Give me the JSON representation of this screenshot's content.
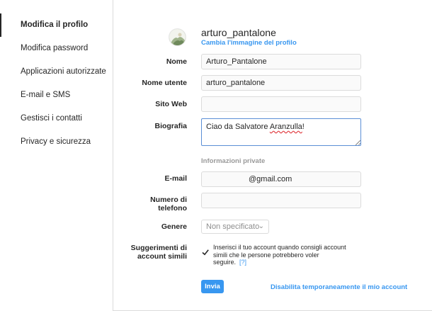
{
  "sidebar": {
    "items": [
      {
        "label": "Modifica il profilo",
        "active": true
      },
      {
        "label": "Modifica password"
      },
      {
        "label": "Applicazioni autorizzate"
      },
      {
        "label": "E-mail e SMS"
      },
      {
        "label": "Gestisci i contatti"
      },
      {
        "label": "Privacy e sicurezza"
      }
    ]
  },
  "profile": {
    "username": "arturo_pantalone",
    "change_photo": "Cambia l'immagine del profilo"
  },
  "form": {
    "name_label": "Nome",
    "name_value": "Arturo_Pantalone",
    "username_label": "Nome utente",
    "username_value": "arturo_pantalone",
    "website_label": "Sito Web",
    "website_value": "",
    "bio_label": "Biografia",
    "bio_prefix": "Ciao da Salvatore ",
    "bio_misspelled": "Aranzulla",
    "bio_suffix": "!",
    "private_info_title": "Informazioni private",
    "email_label": "E-mail",
    "email_value": "@gmail.com",
    "phone_label_1": "Numero di",
    "phone_label_2": "telefono",
    "phone_value": "",
    "gender_label": "Genere",
    "gender_value": "Non specificato",
    "suggest_label_1": "Suggerimenti di",
    "suggest_label_2": "account simili",
    "suggest_text": "Inserisci il tuo account quando consigli account simili che le persone potrebbero voler seguire.",
    "suggest_help": "[?]",
    "suggest_checked": true,
    "submit_label": "Invia",
    "disable_link": "Disabilita temporaneamente il mio account"
  },
  "colors": {
    "accent": "#3897f0",
    "text": "#262626",
    "border": "#dbdbdb"
  }
}
